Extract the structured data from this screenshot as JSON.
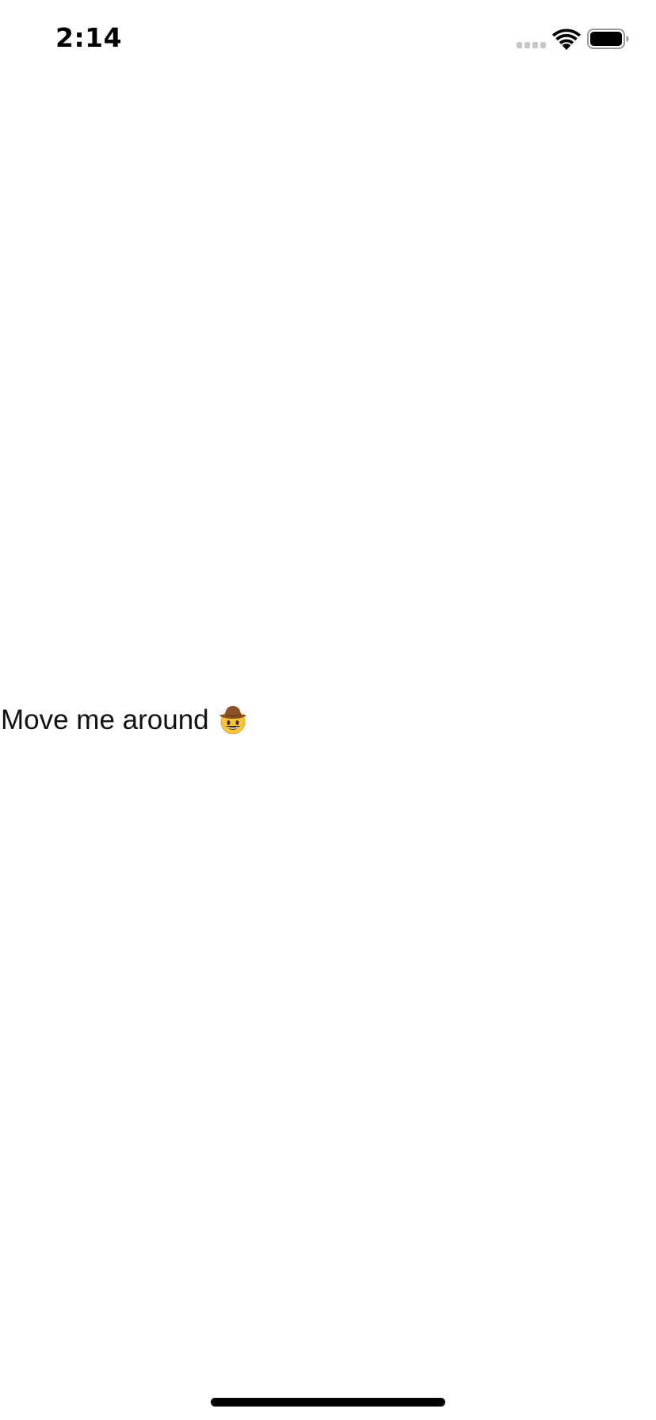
{
  "status_bar": {
    "time": "2:14",
    "signal_icon": "cellular-signal-icon",
    "wifi_icon": "wifi-icon",
    "battery_icon": "battery-icon",
    "battery_level": 1.0
  },
  "content": {
    "draggable_text": "Move me around",
    "emoji_icon": "cowboy-hat-face-icon"
  },
  "colors": {
    "background": "#ffffff",
    "text": "#111111",
    "signal_inactive": "#c8c8c8"
  },
  "home_indicator_icon": "home-indicator"
}
